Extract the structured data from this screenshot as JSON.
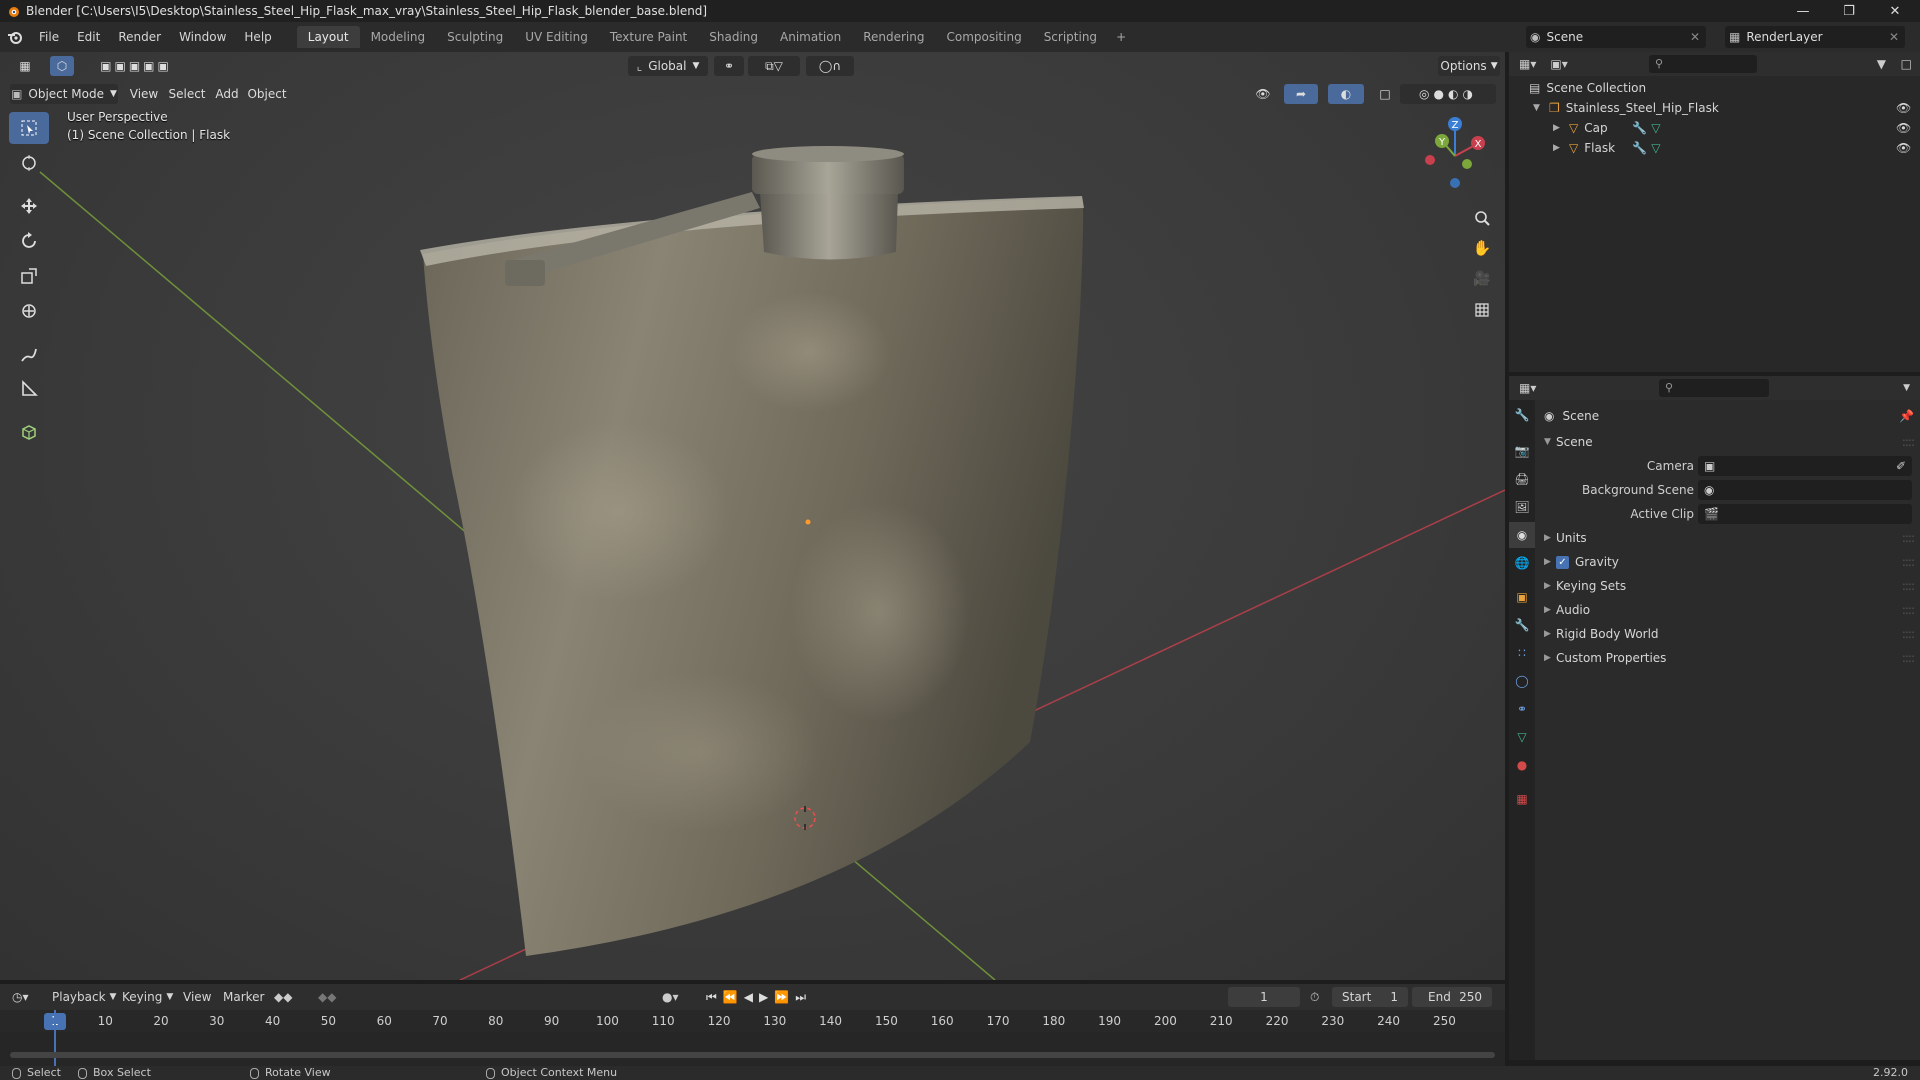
{
  "window": {
    "title": "Blender [C:\\Users\\I5\\Desktop\\Stainless_Steel_Hip_Flask_max_vray\\Stainless_Steel_Hip_Flask_blender_base.blend]",
    "controls": [
      "minimize-icon",
      "maximize-icon",
      "close-icon"
    ]
  },
  "menu": {
    "items": [
      "File",
      "Edit",
      "Render",
      "Window",
      "Help"
    ],
    "workspaces": [
      "Layout",
      "Modeling",
      "Sculpting",
      "UV Editing",
      "Texture Paint",
      "Shading",
      "Animation",
      "Rendering",
      "Compositing",
      "Scripting"
    ],
    "active_workspace": "Layout",
    "add_workspace": "+",
    "scene": "Scene",
    "render_layer": "RenderLayer"
  },
  "viewport": {
    "mode": "Object Mode",
    "menus": [
      "View",
      "Select",
      "Add",
      "Object"
    ],
    "transform_orientation": "Global",
    "options_label": "Options",
    "info_line1": "User Perspective",
    "info_line2": "(1) Scene Collection | Flask",
    "gizmo_axes": {
      "x": "X",
      "y": "Y",
      "z": "Z"
    },
    "tools": [
      "select-box-icon",
      "cursor-icon",
      "move-icon",
      "rotate-icon",
      "scale-icon",
      "transform-icon",
      "annotate-icon",
      "measure-icon",
      "add-cube-icon"
    ],
    "colors": {
      "x_axis": "#c8404d",
      "y_axis": "#7ca73a",
      "z_axis": "#3a7fd5",
      "active_tool": "#4a6a9c"
    }
  },
  "outliner": {
    "root": "Scene Collection",
    "items": [
      {
        "label": "Stainless_Steel_Hip_Flask",
        "level": 1
      },
      {
        "label": "Cap",
        "level": 2
      },
      {
        "label": "Flask",
        "level": 2
      }
    ]
  },
  "properties": {
    "context_title": "Scene",
    "section": "Scene",
    "fields": [
      {
        "label": "Camera",
        "value": ""
      },
      {
        "label": "Background Scene",
        "value": ""
      },
      {
        "label": "Active Clip",
        "value": ""
      }
    ],
    "panels": [
      "Units",
      "Gravity",
      "Keying Sets",
      "Audio",
      "Rigid Body World",
      "Custom Properties"
    ],
    "gravity_checked": true
  },
  "timeline": {
    "menus": [
      "Playback",
      "Keying",
      "View",
      "Marker"
    ],
    "current_frame": "1",
    "start_label": "Start",
    "start": "1",
    "end_label": "End",
    "end": "250",
    "ticks": [
      "1",
      "10",
      "20",
      "30",
      "40",
      "50",
      "60",
      "70",
      "80",
      "90",
      "100",
      "110",
      "120",
      "130",
      "140",
      "150",
      "160",
      "170",
      "180",
      "190",
      "200",
      "210",
      "220",
      "230",
      "240",
      "250"
    ]
  },
  "statusbar": {
    "select": "Select",
    "box_select": "Box Select",
    "rotate_view": "Rotate View",
    "context_menu": "Object Context Menu",
    "version": "2.92.0"
  }
}
